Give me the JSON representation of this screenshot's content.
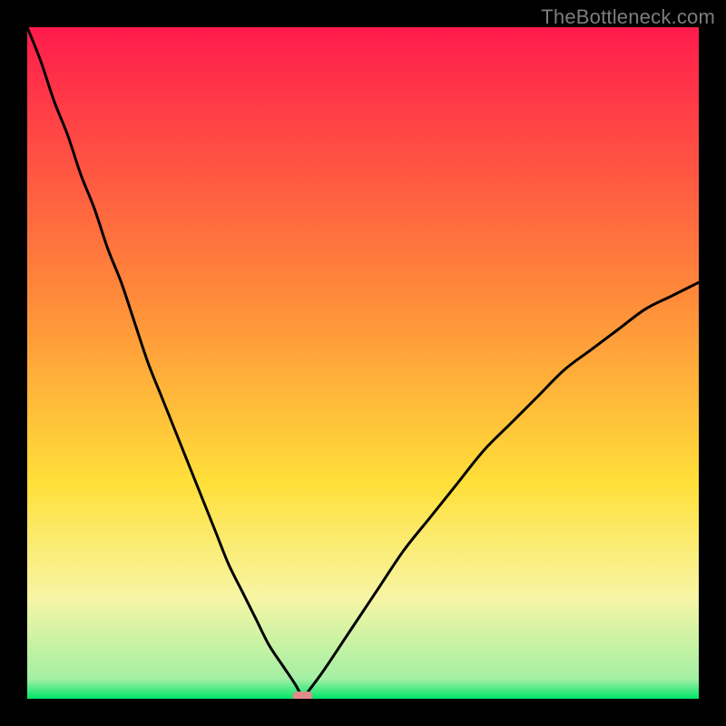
{
  "watermark": "TheBottleneck.com",
  "colors": {
    "frame": "#000000",
    "grad_top": "#ff1b4c",
    "grad_mid1": "#ff8a3a",
    "grad_mid2": "#ffe03a",
    "grad_band": "#f7f5a5",
    "grad_bottom": "#00e56a",
    "curve": "#000000",
    "marker": "#e08d8a"
  },
  "chart_data": {
    "type": "line",
    "title": "",
    "xlabel": "",
    "ylabel": "",
    "xlim": [
      0,
      100
    ],
    "ylim": [
      0,
      100
    ],
    "notch_x": 41,
    "marker": {
      "x": 41,
      "y": 0,
      "color": "#e08d8a"
    },
    "gradient_stops": [
      {
        "pos": 0.0,
        "color": "#ff1b4c"
      },
      {
        "pos": 0.4,
        "color": "#ff8a3a"
      },
      {
        "pos": 0.68,
        "color": "#ffe03a"
      },
      {
        "pos": 0.85,
        "color": "#f7f5a5"
      },
      {
        "pos": 0.97,
        "color": "#a4f0a4"
      },
      {
        "pos": 1.0,
        "color": "#00e56a"
      }
    ],
    "series": [
      {
        "name": "left-branch",
        "x": [
          0,
          2,
          4,
          6,
          8,
          10,
          12,
          14,
          16,
          18,
          20,
          22,
          24,
          26,
          28,
          30,
          32,
          34,
          36,
          38,
          40,
          41
        ],
        "y": [
          100,
          95,
          89,
          84,
          78,
          73,
          67,
          62,
          56,
          50,
          45,
          40,
          35,
          30,
          25,
          20,
          16,
          12,
          8,
          5,
          2,
          0
        ]
      },
      {
        "name": "right-branch",
        "x": [
          41,
          44,
          48,
          52,
          56,
          60,
          64,
          68,
          72,
          76,
          80,
          84,
          88,
          92,
          96,
          100
        ],
        "y": [
          0,
          4,
          10,
          16,
          22,
          27,
          32,
          37,
          41,
          45,
          49,
          52,
          55,
          58,
          60,
          62
        ]
      }
    ]
  }
}
